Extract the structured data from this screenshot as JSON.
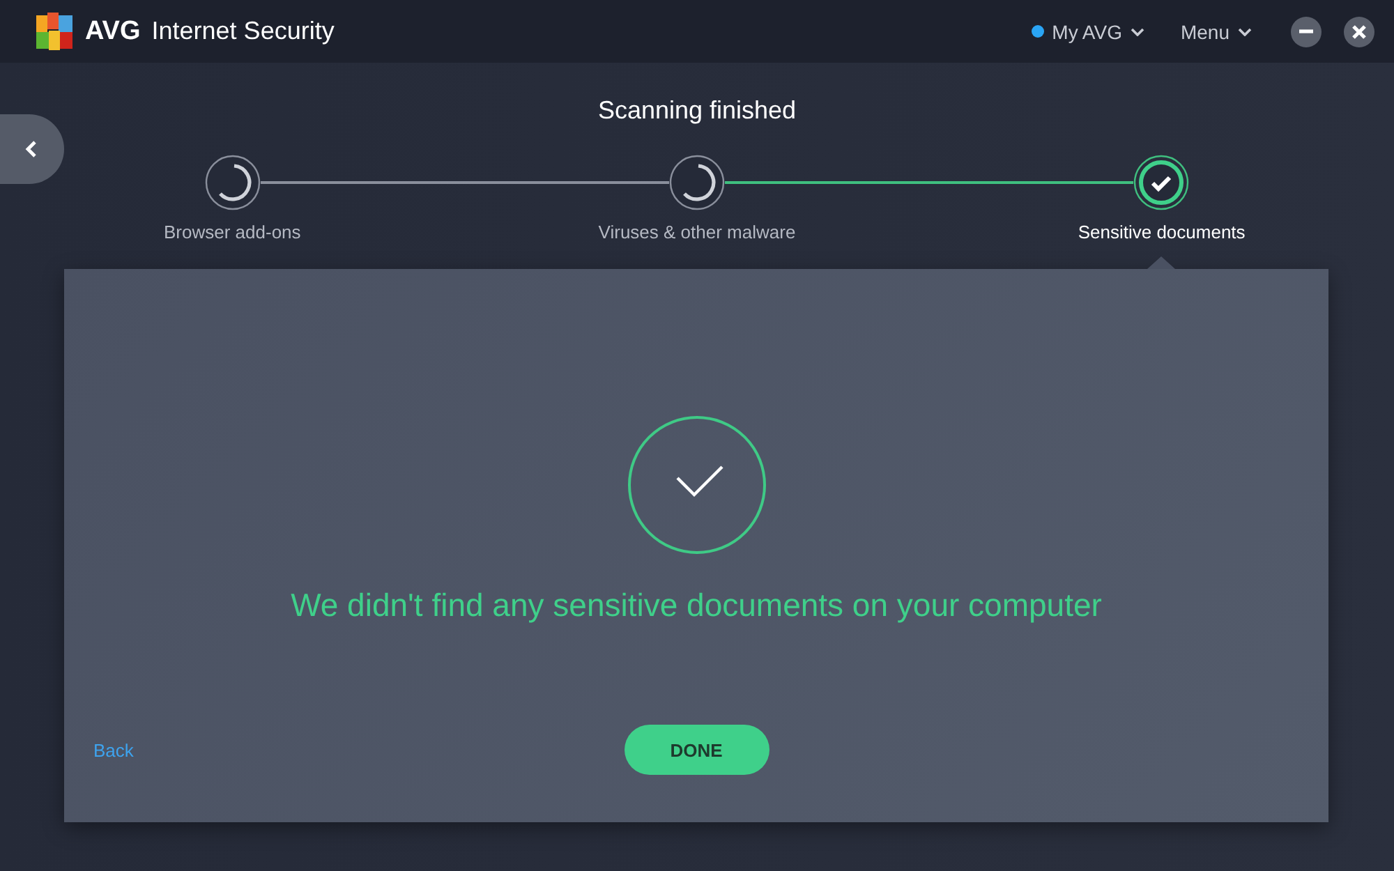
{
  "window": {
    "brand": "AVG",
    "product": "Internet Security"
  },
  "account_menu": {
    "label": "My AVG"
  },
  "main_menu": {
    "label": "Menu"
  },
  "scan": {
    "title": "Scanning finished",
    "steps": [
      {
        "label": "Browser add-ons",
        "done": false,
        "selected": false
      },
      {
        "label": "Viruses & other malware",
        "done": false,
        "selected": false
      },
      {
        "label": "Sensitive documents",
        "done": true,
        "selected": true
      }
    ]
  },
  "result": {
    "message": "We didn't find any sensitive documents on your computer",
    "back_link": "Back",
    "done_button": "DONE"
  }
}
